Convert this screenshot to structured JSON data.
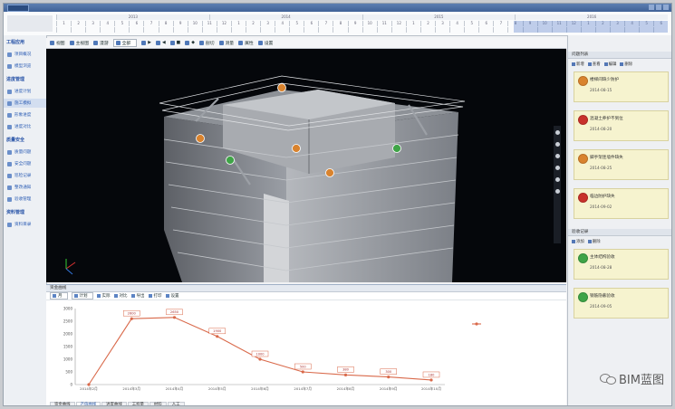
{
  "app": {
    "logo_text": "",
    "title": ""
  },
  "timeline": {
    "years": [
      "2013",
      "2014",
      "2015",
      "2016"
    ],
    "months": [
      "1",
      "2",
      "3",
      "4",
      "5",
      "6",
      "7",
      "8",
      "9",
      "10",
      "11",
      "12",
      "1",
      "2",
      "3",
      "4",
      "5",
      "6",
      "7",
      "8",
      "9",
      "10",
      "11",
      "12",
      "1",
      "2",
      "3",
      "4",
      "5",
      "6",
      "7",
      "8",
      "9",
      "10",
      "11",
      "12",
      "1",
      "2",
      "3",
      "4",
      "5",
      "6"
    ]
  },
  "leftnav": {
    "groups": [
      {
        "label": "工程应用",
        "items": [
          "项目概况",
          "模型浏览"
        ]
      },
      {
        "label": "进度管理",
        "items": [
          "进度计划",
          "施工模拟",
          "形象进度",
          "进度对比"
        ]
      },
      {
        "label": "质量安全",
        "items": [
          "质量问题",
          "安全问题",
          "巡检记录",
          "整改通知",
          "验收管理"
        ]
      },
      {
        "label": "资料管理",
        "items": [
          "资料目录"
        ]
      }
    ]
  },
  "toolbar": {
    "items": [
      "视图",
      "主视图",
      "漫游",
      "全部",
      "▶",
      "◀",
      "■",
      "◆",
      "剖切",
      "测量",
      "属性",
      "设置"
    ]
  },
  "chart_panel": {
    "header": "资金曲线",
    "tools": [
      "月",
      "计划",
      "实际",
      "对比",
      "导出",
      "打印",
      "设置"
    ],
    "tabs": [
      "资金曲线",
      "产值曲线",
      "进度曲线",
      "工程量",
      "材料",
      "人工"
    ],
    "active_tab": 1
  },
  "chart_data": {
    "type": "line",
    "x": [
      "2014年2月",
      "2014年3月",
      "2014年4月",
      "2014年5月",
      "2014年6月",
      "2014年7月",
      "2014年8月",
      "2014年9月",
      "2014年10月"
    ],
    "series": [
      {
        "name": "",
        "values": [
          0,
          2600,
          2650,
          1900,
          1000,
          500,
          380,
          300,
          180
        ],
        "color": "#d9694a"
      }
    ],
    "ylim": [
      0,
      3000
    ],
    "yticks": [
      0,
      500,
      1000,
      1500,
      2000,
      2500,
      3000
    ],
    "grid": false,
    "legend": "top-right"
  },
  "right_panel": {
    "sec1_header": "问题列表",
    "sec1_tools": [
      "新增",
      "查看",
      "编辑",
      "删除"
    ],
    "issues": [
      {
        "title": "楼梯间缺少防护",
        "meta": "2014-08-15",
        "color": "#d9832e"
      },
      {
        "title": "混凝土养护不到位",
        "meta": "2014-08-20",
        "color": "#c8312b"
      },
      {
        "title": "脚手架连墙件缺失",
        "meta": "2014-08-25",
        "color": "#d9832e"
      },
      {
        "title": "临边防护缺失",
        "meta": "2014-09-02",
        "color": "#c8312b"
      }
    ],
    "sec2_header": "验收记录",
    "sec2_tools": [
      "添加",
      "删除"
    ],
    "records": [
      {
        "title": "主体结构验收",
        "meta": "2014-08-28",
        "color": "#3fa447"
      },
      {
        "title": "钢筋隐蔽验收",
        "meta": "2014-09-05",
        "color": "#3fa447"
      }
    ]
  },
  "watermark": "BIM蓝图"
}
